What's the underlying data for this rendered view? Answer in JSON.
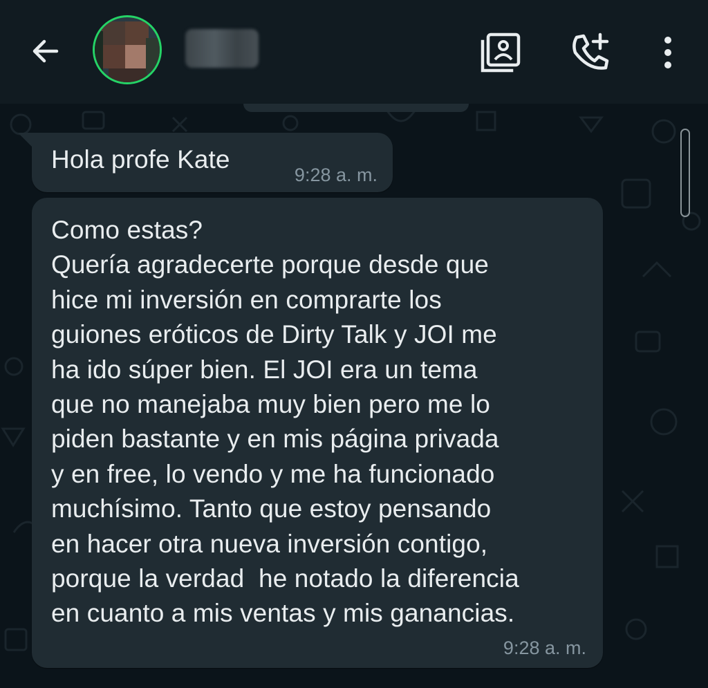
{
  "header": {
    "contact_name": "",
    "icons": [
      "back-arrow-icon",
      "contact-avatar",
      "video-call-icon",
      "add-call-icon",
      "more-options-icon"
    ]
  },
  "messages": [
    {
      "text": "Hola profe Kate",
      "time": "9:28 a. m."
    },
    {
      "text": "Como estas?\nQuería agradecerte porque desde que\nhice mi inversión en comprarte los\nguiones eróticos de Dirty Talk y JOI me\nha ido súper bien. El JOI era un tema\nque no manejaba muy bien pero me lo\npiden bastante y en mis página privada\ny en free, lo vendo y me ha funcionado\nmuchísimo. Tanto que estoy pensando\nen hacer otra nueva inversión contigo,\nporque la verdad  he notado la diferencia\nen cuanto a mis ventas y mis ganancias.",
      "time": "9:28 a. m."
    }
  ],
  "colors": {
    "header_bg": "#111b21",
    "chat_bg": "#0b141a",
    "bubble_bg": "#202c33",
    "text": "#e9edef",
    "meta": "#8696a0",
    "avatar_ring": "#25d366"
  }
}
